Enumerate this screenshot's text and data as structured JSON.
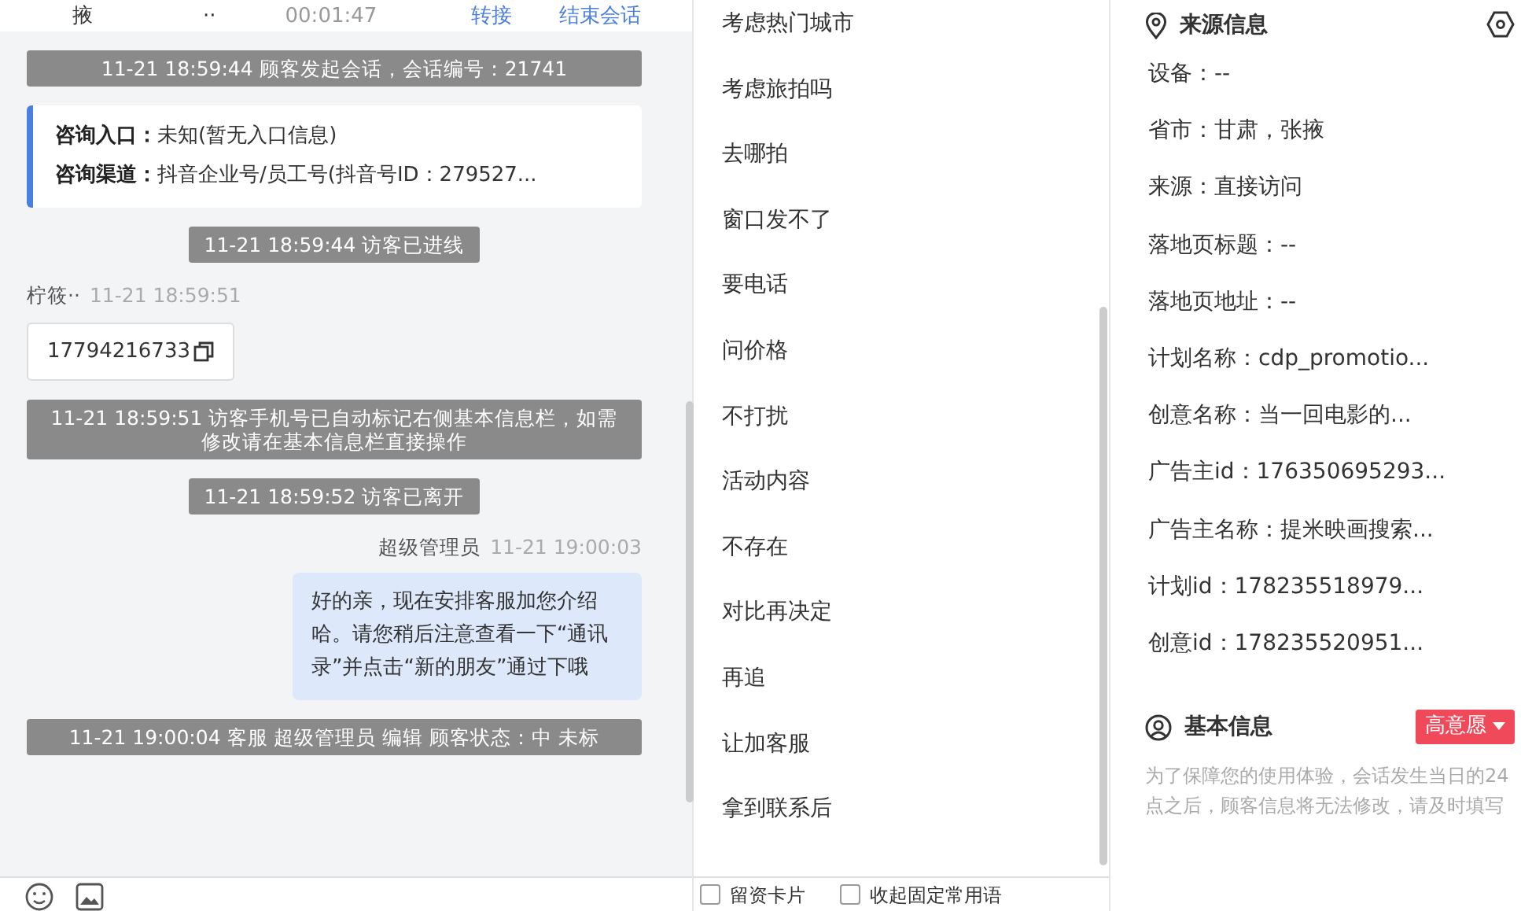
{
  "header": {
    "location": "掖",
    "status": "··",
    "duration": "00:01:47",
    "transfer": "转接",
    "end_session": "结束会话"
  },
  "messages": [
    {
      "kind": "system",
      "text": "11-21 18:59:44 顾客发起会话，会话编号：21741"
    },
    {
      "kind": "info",
      "fields": [
        {
          "label": "咨询入口：",
          "value": "未知(暂无入口信息)"
        },
        {
          "label": "咨询渠道：",
          "value": "抖音企业号/员工号(抖音号ID：279527..."
        }
      ]
    },
    {
      "kind": "system",
      "text": "11-21 18:59:44 访客已进线"
    },
    {
      "kind": "visitor",
      "sender": "柠筱··",
      "time": "11-21 18:59:51",
      "text": "17794216733"
    },
    {
      "kind": "system",
      "text": "11-21 18:59:51 访客手机号已自动标记右侧基本信息栏，如需修改请在基本信息栏直接操作"
    },
    {
      "kind": "system",
      "text": "11-21 18:59:52 访客已离开"
    },
    {
      "kind": "agent",
      "sender": "超级管理员",
      "time": "11-21 19:00:03",
      "text": "好的亲，现在安排客服加您介绍哈。请您稍后注意查看一下“通讯录”并点击“新的朋友”通过下哦"
    },
    {
      "kind": "system",
      "text": "11-21 19:00:04 客服 超级管理员 编辑 顾客状态：中 未标"
    }
  ],
  "phrases": [
    "考虑热门城市",
    "考虑旅拍吗",
    "去哪拍",
    "窗口发不了",
    "要电话",
    "问价格",
    "不打扰",
    "活动内容",
    "不存在",
    "对比再决定",
    "再追",
    "让加客服",
    "拿到联系后"
  ],
  "options": [
    {
      "label": "留资卡片",
      "checked": false
    },
    {
      "label": "收起固定常用语",
      "checked": false
    }
  ],
  "source_info": {
    "title": "来源信息",
    "rows": [
      "设备：--",
      "省市：甘肃，张掖",
      "来源：直接访问",
      "落地页标题：--",
      "落地页地址：--",
      "计划名称：cdp_promotio...",
      "创意名称：当一回电影的...",
      "广告主id：176350695293...",
      "广告主名称：提米映画搜索...",
      "计划id：178235518979...",
      "创意id：178235520951..."
    ]
  },
  "basic_info": {
    "title": "基本信息",
    "intent": "高意愿",
    "note": "为了保障您的使用体验，会话发生当日的24点之后，顾客信息将无法修改，请及时填写"
  }
}
